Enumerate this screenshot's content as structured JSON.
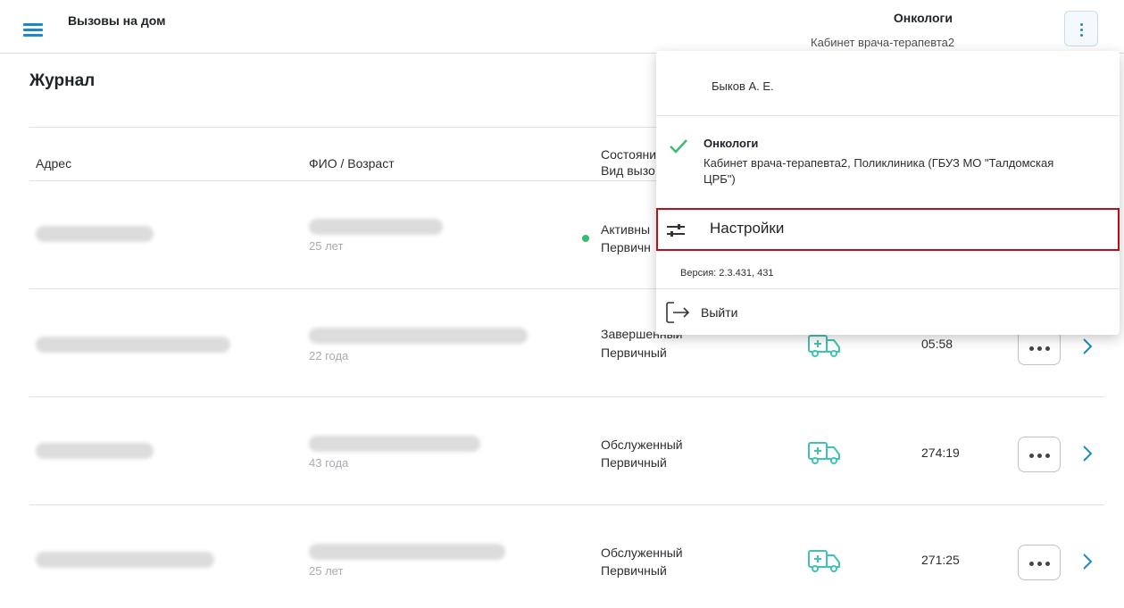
{
  "header": {
    "app_title": "Вызовы на дом",
    "department": "Онкологи",
    "cabinet": "Кабинет врача-терапевта2",
    "menu_icon": "hamburger-icon",
    "more_icon": "kebab-icon"
  },
  "page_title": "Журнал",
  "table": {
    "columns": {
      "address": "Адрес",
      "fio_age": "ФИО / Возраст",
      "state_line1": "Состояни",
      "state_line2": "Вид вызо"
    },
    "rows": [
      {
        "age": "25 лет",
        "status": "Активны",
        "type": "Первичн",
        "time": ""
      },
      {
        "age": "22 года",
        "status": "Завершенный",
        "type": "Первичный",
        "time": "05:58"
      },
      {
        "age": "43 года",
        "status": "Обслуженный",
        "type": "Первичный",
        "time": "274:19"
      },
      {
        "age": "25 лет",
        "status": "Обслуженный",
        "type": "Первичный",
        "time": "271:25"
      }
    ]
  },
  "menu": {
    "user": "Быков А. Е.",
    "department": "Онкологи",
    "organization": "Кабинет врача-терапевта2, Поликлиника (ГБУЗ МО \"Талдомская ЦРБ\")",
    "settings_label": "Настройки",
    "version": "Версия: 2.3.431, 431",
    "logout_label": "Выйти"
  },
  "colors": {
    "accent": "#1e88c7",
    "icon_teal": "#3fc3b3",
    "active_green": "#34c06a",
    "highlight_red": "#b3121c"
  }
}
